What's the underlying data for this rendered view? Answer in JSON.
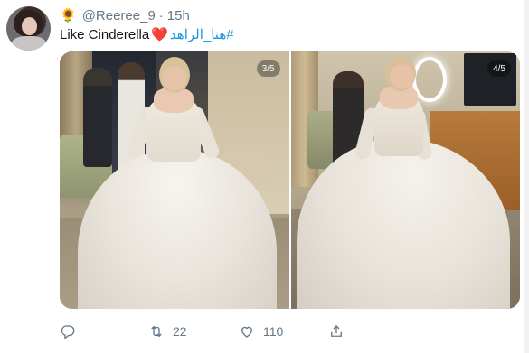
{
  "tweet": {
    "display_emoji": "🌻",
    "handle": "@Reeree_9",
    "separator": "·",
    "timestamp": "15h",
    "text_plain": "Like Cinderella",
    "text_emoji": "❤️",
    "hashtags": "#هنا_الزاهد",
    "media": [
      {
        "counter": "3/5"
      },
      {
        "counter": "4/5"
      }
    ],
    "actions": {
      "reply_count": "",
      "retweet_count": "22",
      "like_count": "110"
    }
  },
  "colors": {
    "handle_gray": "#657786",
    "hashtag_blue": "#1b95e0",
    "heart_red": "#e0245e"
  },
  "icons": [
    "reply-icon",
    "retweet-icon",
    "like-icon",
    "share-icon"
  ]
}
